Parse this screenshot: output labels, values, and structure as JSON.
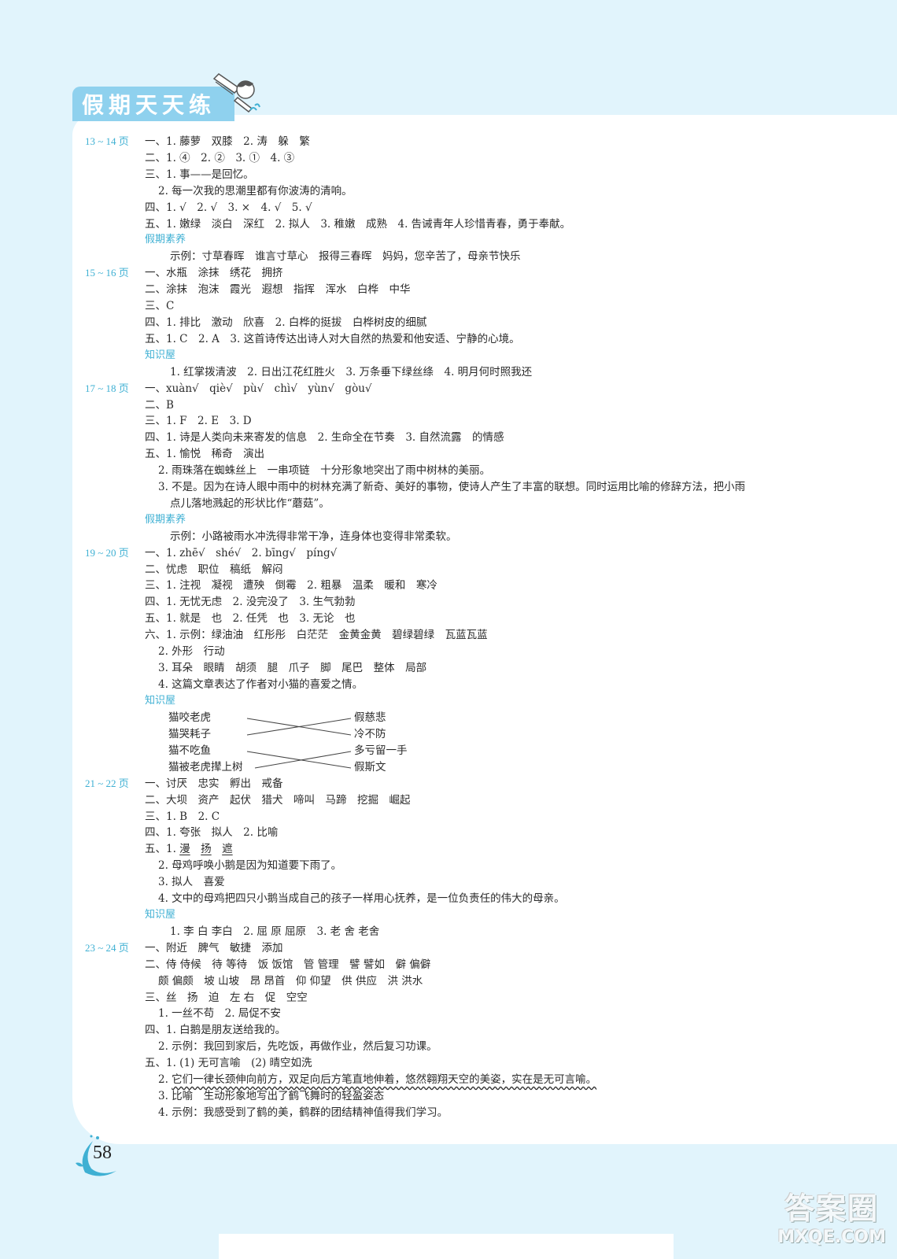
{
  "header": {
    "title": "假期天天练"
  },
  "page_number": "58",
  "watermark": {
    "line1": "答案圈",
    "line2": "MXQE.COM"
  },
  "sections": {
    "p13": {
      "label": "13 ~ 14 页",
      "lines": [
        "一、1. 藤萝　双膝　2. 涛　躲　繁",
        "二、1. ④　2. ②　3. ①　4. ③",
        "三、1. 事——是回忆。",
        "2. 每一次我的思潮里都有你波涛的清响。",
        "四、1. √　2. √　3. ×　4. √　5. √",
        "五、1. 嫩绿　淡白　深红　2. 拟人　3. 稚嫩　成熟　4. 告诫青年人珍惜青春，勇于奉献。"
      ],
      "extra_title": "假期素养",
      "extra_lines": [
        "示例：寸草春晖　谁言寸草心　报得三春晖　妈妈，您辛苦了，母亲节快乐"
      ]
    },
    "p15": {
      "label": "15 ~ 16 页",
      "lines": [
        "一、水瓶　涂抹　绣花　拥挤",
        "二、涂抹　泡沫　霞光　遐想　指挥　浑水　白桦　中华",
        "三、C",
        "四、1. 排比　激动　欣喜　2. 白桦的挺拔　白桦树皮的细腻",
        "五、1. C　2. A　3. 这首诗传达出诗人对大自然的热爱和他安适、宁静的心境。"
      ],
      "extra_title": "知识屋",
      "extra_lines": [
        "1. 红掌拨清波　2. 日出江花红胜火　3. 万条垂下绿丝绦　4. 明月何时照我还"
      ]
    },
    "p17": {
      "label": "17 ~ 18 页",
      "lines": [
        "一、xuàn√　qiè√　pù√　chì√　yùn√　gòu√",
        "二、B",
        "三、1. F　2. E　3. D",
        "四、1. 诗是人类向未来寄发的信息　2. 生命全在节奏　3. 自然流露　的情感",
        "五、1. 愉悦　稀奇　演出",
        "2. 雨珠落在蜘蛛丝上　一串项链　十分形象地突出了雨中树林的美丽。",
        "3. 不是。因为在诗人眼中雨中的树林充满了新奇、美好的事物，使诗人产生了丰富的联想。同时运用比喻的修辞方法，把小雨",
        "点儿落地溅起的形状比作“蘑菇”。"
      ],
      "extra_title": "假期素养",
      "extra_lines": [
        "示例：小路被雨水冲洗得非常干净，连身体也变得非常柔软。"
      ]
    },
    "p19": {
      "label": "19 ~ 20 页",
      "lines": [
        "一、1. zhē√　shé√　2. bīng√　píng√",
        "二、忧虑　职位　稿纸　解闷",
        "三、1. 注视　凝视　遭殃　倒霉　2. 粗暴　温柔　暖和　寒冷",
        "四、1. 无忧无虑　2. 没完没了　3. 生气勃勃",
        "五、1. 就是　也　2. 任凭　也　3. 无论　也",
        "六、1. 示例：绿油油　红彤彤　白茫茫　金黄金黄　碧绿碧绿　瓦蓝瓦蓝",
        "2. 外形　行动",
        "3. 耳朵　眼睛　胡须　腿　爪子　脚　尾巴　整体　局部",
        "4. 这篇文章表达了作者对小猫的喜爱之情。"
      ],
      "extra_title": "知识屋",
      "matching": {
        "left": [
          "猫咬老虎",
          "猫哭耗子",
          "猫不吃鱼",
          "猫被老虎撵上树"
        ],
        "right": [
          "假慈悲",
          "冷不防",
          "多亏留一手",
          "假斯文"
        ],
        "pairs": [
          [
            0,
            1
          ],
          [
            1,
            0
          ],
          [
            2,
            3
          ],
          [
            3,
            2
          ]
        ]
      }
    },
    "p21": {
      "label": "21 ~ 22 页",
      "lines": [
        "一、讨厌　忠实　孵出　戒备",
        "二、大坝　资产　起伏　猎犬　啼叫　马蹄　挖掘　崛起",
        "三、1. B　2. C",
        "四、1. 夸张　拟人　2. 比喻"
      ],
      "line5_prefix": "五、1. ",
      "line5_underlined": [
        "漫",
        "扬",
        "遮"
      ],
      "lines_after": [
        "2. 母鸡呼唤小鹅是因为知道要下雨了。",
        "3. 拟人　喜爱",
        "4. 文中的母鸡把四只小鹅当成自己的孩子一样用心抚养，是一位负责任的伟大的母亲。"
      ],
      "extra_title": "知识屋",
      "extra_lines": [
        "1. 李 白 李白　2. 屈 原 屈原　3. 老 舍 老舍"
      ]
    },
    "p23": {
      "label": "23 ~ 24 页",
      "lines": [
        "一、附近　脾气　敏捷　添加",
        "二、侍 侍候　待 等待　饭 饭馆　管 管理　譬 譬如　僻 偏僻",
        "颇 偏颇　坡 山坡　昂 昂首　仰 仰望　供 供应　洪 洪水",
        "三、丝　扬　迫　左 右　促　空空",
        "1. 一丝不苟　2. 局促不安",
        "四、1. 白鹅是朋友送给我的。",
        "2. 示例：我回到家后，先吃饭，再做作业，然后复习功课。",
        "五、1. (1) 无可言喻　(2) 晴空如洗"
      ],
      "wavy_prefix": "2. ",
      "wavy_text": "它们一律长颈伸向前方，双足向后方笔直地伸着，悠然翱翔天空的美姿，实在是无可言喻。",
      "lines_after": [
        "3. 比喻　生动形象地写出了鹤飞舞时的轻盈姿态",
        "4. 示例：我感受到了鹤的美，鹤群的团结精神值得我们学习。"
      ]
    }
  }
}
